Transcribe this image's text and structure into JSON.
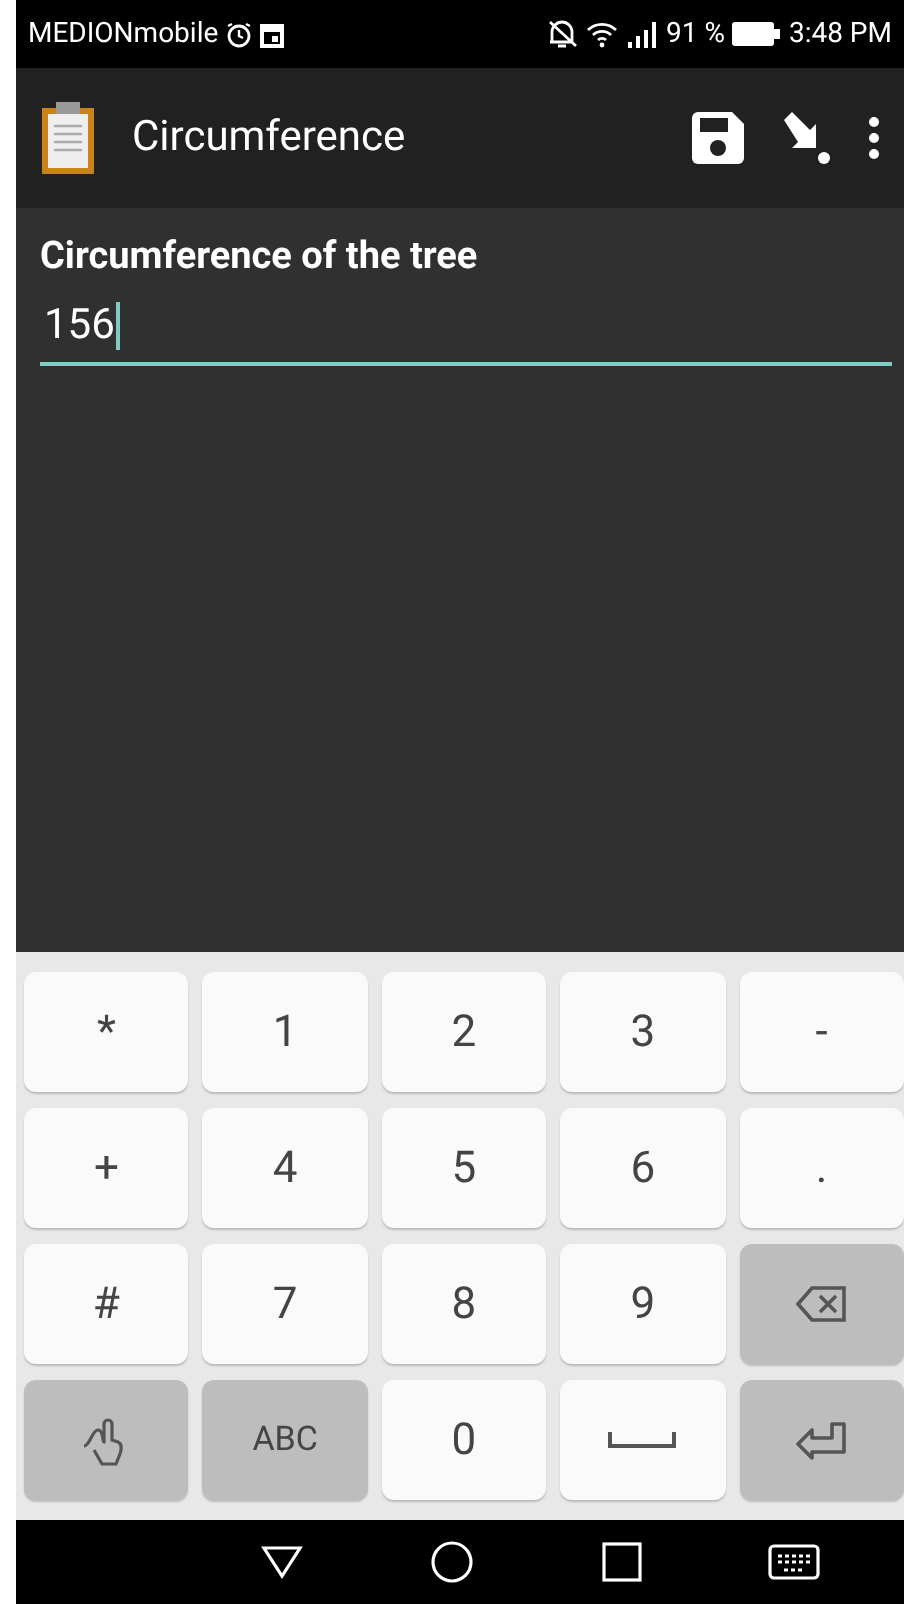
{
  "status_bar": {
    "carrier": "MEDIONmobile",
    "battery": "91 %",
    "time": "3:48 PM"
  },
  "app_bar": {
    "title": "Circumference"
  },
  "form": {
    "label": "Circumference of the tree",
    "value": "156"
  },
  "keyboard": {
    "keys": [
      {
        "kind": "char",
        "label": "*",
        "special": false
      },
      {
        "kind": "char",
        "label": "1",
        "special": false
      },
      {
        "kind": "char",
        "label": "2",
        "special": false
      },
      {
        "kind": "char",
        "label": "3",
        "special": false
      },
      {
        "kind": "char",
        "label": "-",
        "special": false
      },
      {
        "kind": "char",
        "label": "+",
        "special": false
      },
      {
        "kind": "char",
        "label": "4",
        "special": false
      },
      {
        "kind": "char",
        "label": "5",
        "special": false
      },
      {
        "kind": "char",
        "label": "6",
        "special": false
      },
      {
        "kind": "char",
        "label": ".",
        "special": false
      },
      {
        "kind": "char",
        "label": "#",
        "special": false
      },
      {
        "kind": "char",
        "label": "7",
        "special": false
      },
      {
        "kind": "char",
        "label": "8",
        "special": false
      },
      {
        "kind": "char",
        "label": "9",
        "special": false
      },
      {
        "kind": "backspace",
        "special": true
      },
      {
        "kind": "handwriting",
        "special": true
      },
      {
        "kind": "char",
        "label": "ABC",
        "special": true
      },
      {
        "kind": "char",
        "label": "0",
        "special": false
      },
      {
        "kind": "space",
        "special": false
      },
      {
        "kind": "enter",
        "special": true
      }
    ]
  }
}
